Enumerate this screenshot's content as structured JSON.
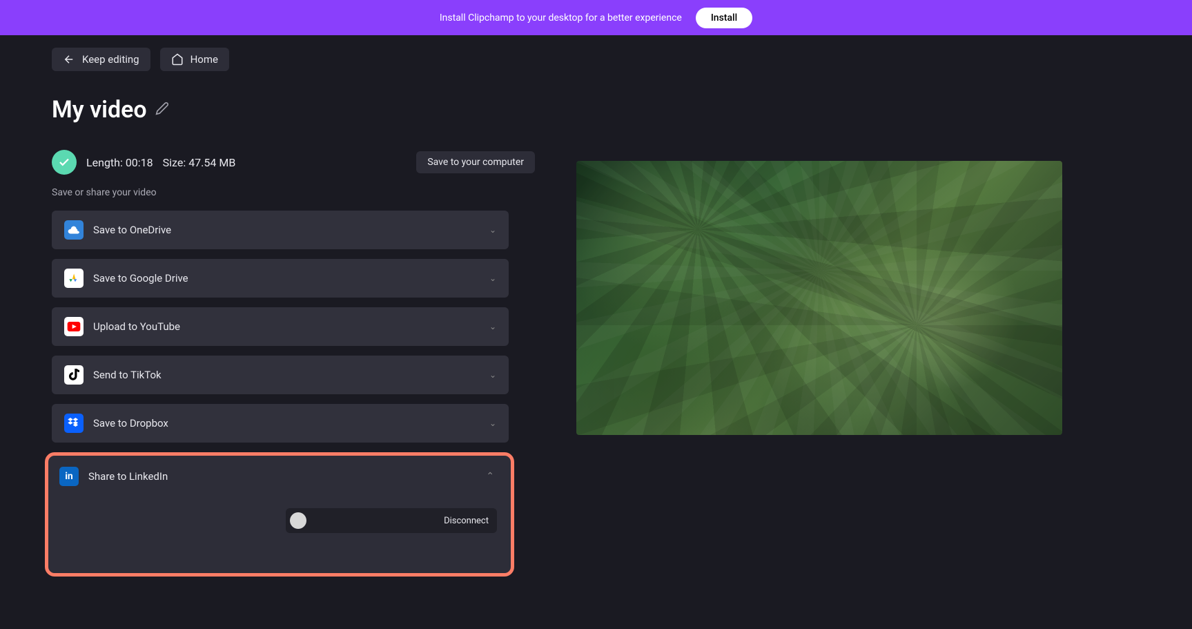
{
  "banner": {
    "text": "Install Clipchamp to your desktop for a better experience",
    "install_label": "Install"
  },
  "nav": {
    "keep_editing_label": "Keep editing",
    "home_label": "Home"
  },
  "video": {
    "title": "My video",
    "length_label": "Length: 00:18",
    "size_label": "Size: 47.54 MB",
    "save_computer_label": "Save to your computer",
    "subtitle": "Save or share your video"
  },
  "share_options": [
    {
      "label": "Save to OneDrive",
      "name": "onedrive"
    },
    {
      "label": "Save to Google Drive",
      "name": "gdrive"
    },
    {
      "label": "Upload to YouTube",
      "name": "youtube"
    },
    {
      "label": "Send to TikTok",
      "name": "tiktok"
    },
    {
      "label": "Save to Dropbox",
      "name": "dropbox"
    }
  ],
  "linkedin": {
    "label": "Share to LinkedIn",
    "disconnect_label": "Disconnect"
  }
}
